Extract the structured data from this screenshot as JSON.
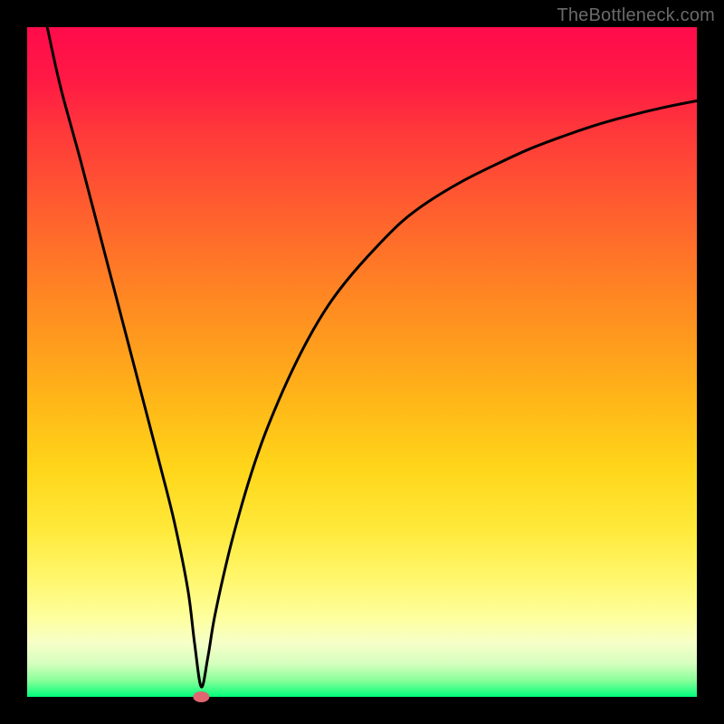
{
  "watermark": "TheBottleneck.com",
  "chart_data": {
    "type": "line",
    "title": "",
    "xlabel": "",
    "ylabel": "",
    "xlim": [
      0,
      100
    ],
    "ylim": [
      0,
      100
    ],
    "grid": false,
    "minimum_marker": {
      "x": 26,
      "y": 0,
      "color": "#e06671"
    },
    "background_gradient": {
      "top": "#ff0b4c",
      "mid": "#ffd61a",
      "bottom": "#00ff7a"
    },
    "series": [
      {
        "name": "bottleneck-curve",
        "color": "#000000",
        "x": [
          3.0,
          5.0,
          8.0,
          11.0,
          14.0,
          17.0,
          20.0,
          22.0,
          24.0,
          25.0,
          26.0,
          27.0,
          28.0,
          30.0,
          32.0,
          34.0,
          36.0,
          39.0,
          42.0,
          45.0,
          48.0,
          52.0,
          56.0,
          60.0,
          65.0,
          70.0,
          75.0,
          80.0,
          85.0,
          90.0,
          95.0,
          100.0
        ],
        "y": [
          100.0,
          91.0,
          80.0,
          68.5,
          57.0,
          45.5,
          34.0,
          26.0,
          16.0,
          8.0,
          1.5,
          6.0,
          12.0,
          21.0,
          28.5,
          35.0,
          40.5,
          47.5,
          53.5,
          58.5,
          62.5,
          67.0,
          71.0,
          74.0,
          77.0,
          79.5,
          81.8,
          83.7,
          85.4,
          86.8,
          88.0,
          89.0
        ]
      }
    ]
  }
}
